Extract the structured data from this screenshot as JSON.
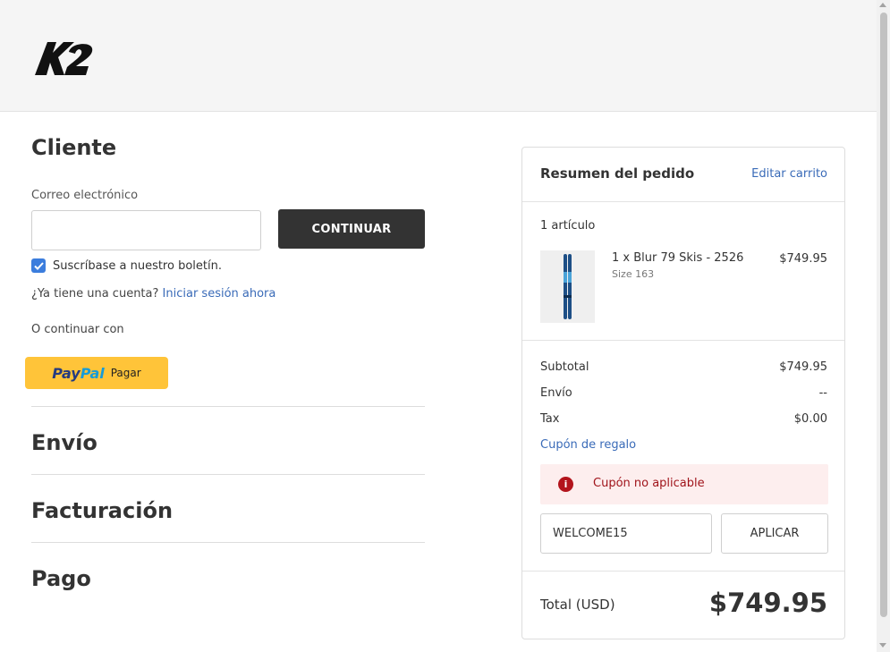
{
  "header": {
    "logo_text": "K2"
  },
  "customer": {
    "title": "Cliente",
    "email_label": "Correo electrónico",
    "email_value": "",
    "continue_label": "CONTINUAR",
    "newsletter_checked": true,
    "newsletter_label": "Suscríbase a nuestro boletín.",
    "account_question": "¿Ya tiene una cuenta?",
    "login_link": "Iniciar sesión ahora",
    "or_continue": "O continuar con",
    "paypal_brand_1": "Pay",
    "paypal_brand_2": "Pal",
    "paypal_label": "Pagar"
  },
  "sections": {
    "shipping": "Envío",
    "billing": "Facturación",
    "payment": "Pago"
  },
  "summary": {
    "title": "Resumen del pedido",
    "edit_cart": "Editar carrito",
    "item_count": "1 artículo",
    "item": {
      "name": "1 x Blur 79 Skis - 2526",
      "size": "Size 163",
      "price": "$749.95"
    },
    "rows": {
      "subtotal_label": "Subtotal",
      "subtotal_value": "$749.95",
      "shipping_label": "Envío",
      "shipping_value": "--",
      "tax_label": "Tax",
      "tax_value": "$0.00"
    },
    "gift_coupon": "Cupón de regalo",
    "error_message": "Cupón no aplicable",
    "coupon_value": "WELCOME15",
    "apply_label": "APLICAR",
    "total_label": "Total (USD)",
    "total_value": "$749.95"
  },
  "colors": {
    "accent_link": "#3a6bb8",
    "error": "#b3141c",
    "primary_button": "#333333",
    "paypal_yellow": "#ffc439"
  }
}
